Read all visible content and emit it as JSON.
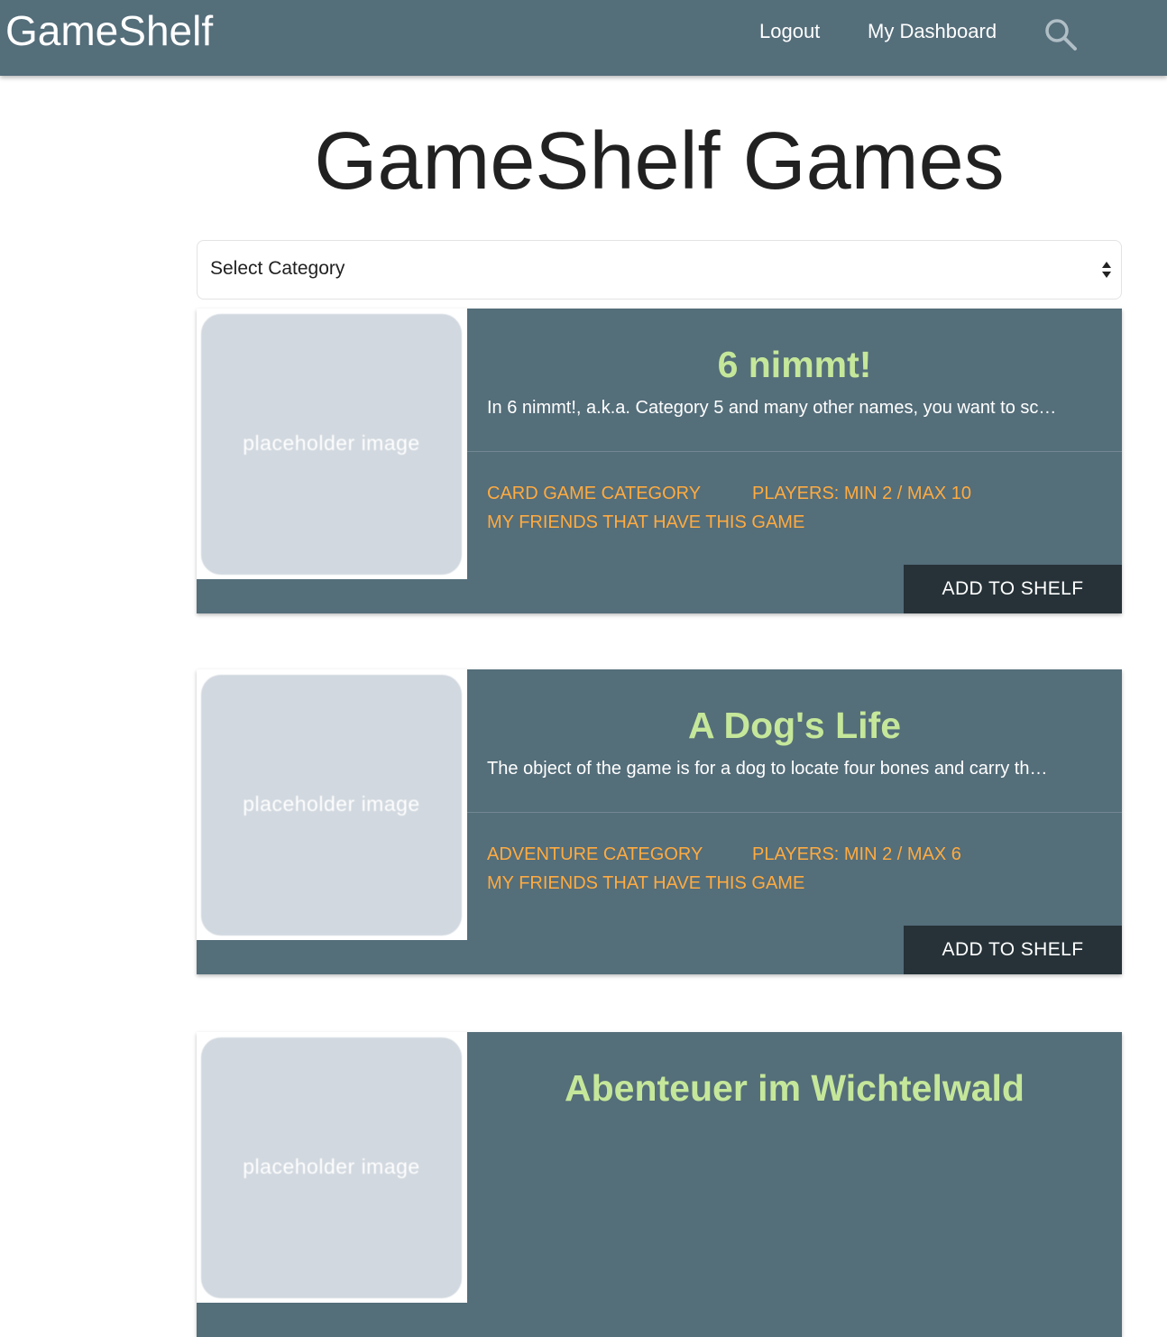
{
  "navbar": {
    "brand": "GameShelf",
    "links": {
      "logout": "Logout",
      "dashboard": "My Dashboard"
    },
    "search_icon": "search-icon"
  },
  "page": {
    "title": "GameShelf Games"
  },
  "filter": {
    "selected": "Select Category"
  },
  "colors": {
    "navbar_bg": "#546e7a",
    "card_bg": "#546e7a",
    "title_green": "#c5e79a",
    "meta_orange": "#ffab40",
    "button_dark": "#263238"
  },
  "games": [
    {
      "title": "6 nimmt!",
      "description": "In 6 nimmt!, a.k.a. Category 5 and many other names, you want to sc…",
      "image_text": "placeholder image",
      "category": "CARD GAME CATEGORY",
      "players": "PLAYERS: MIN 2 / MAX 10",
      "friends": "MY FRIENDS THAT HAVE THIS GAME",
      "button": "ADD TO SHELF"
    },
    {
      "title": "A Dog's Life",
      "description": "The object of the game is for a dog to locate four bones and carry th…",
      "image_text": "placeholder image",
      "category": "ADVENTURE CATEGORY",
      "players": "PLAYERS: MIN 2 / MAX 6",
      "friends": "MY FRIENDS THAT HAVE THIS GAME",
      "button": "ADD TO SHELF"
    },
    {
      "title": "Abenteuer im Wichtelwald",
      "image_text": "placeholder image"
    }
  ]
}
